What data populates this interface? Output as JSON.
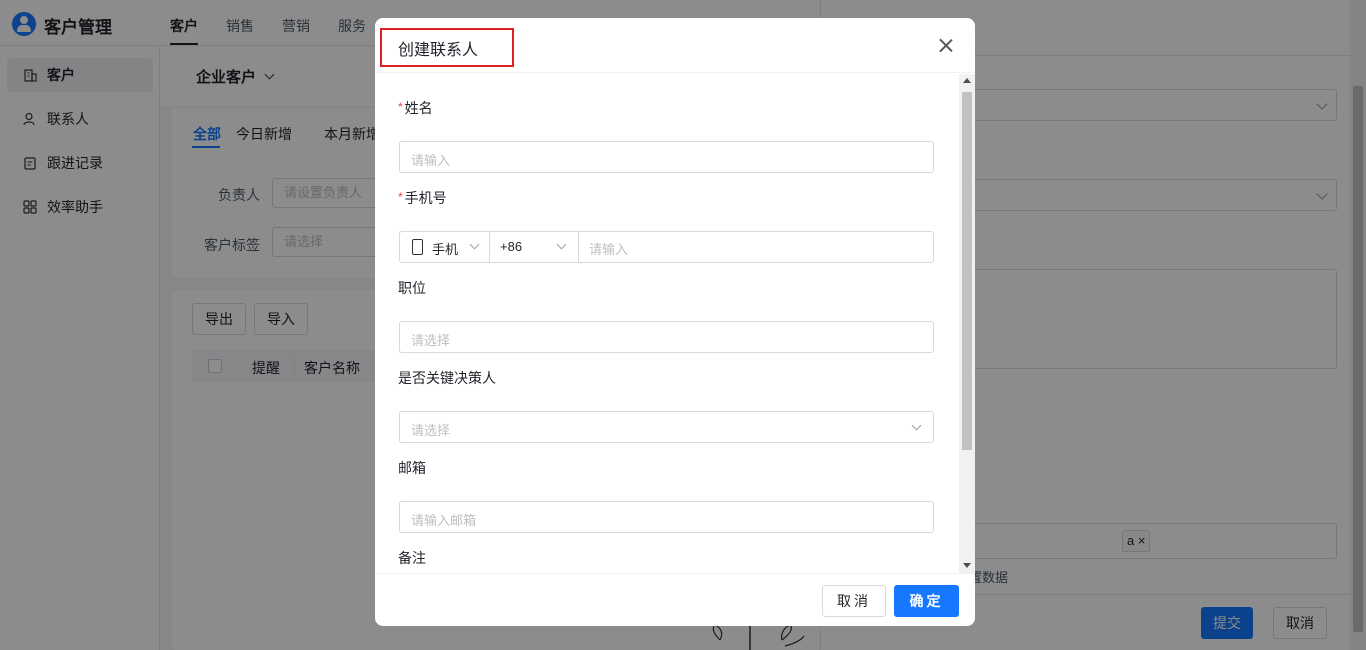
{
  "app": {
    "title": "客户管理",
    "top_tabs": [
      "客户",
      "销售",
      "营销",
      "服务"
    ]
  },
  "sidebar": {
    "items": [
      {
        "label": "客户",
        "icon": "building-icon"
      },
      {
        "label": "联系人",
        "icon": "person-icon"
      },
      {
        "label": "跟进记录",
        "icon": "clipboard-icon"
      },
      {
        "label": "效率助手",
        "icon": "grid-icon"
      }
    ]
  },
  "main": {
    "view_select": "企业客户",
    "filter_tabs": [
      "全部",
      "今日新增",
      "本月新增"
    ],
    "owner_label": "负责人",
    "owner_placeholder": "请设置负责人",
    "tag_label": "客户标签",
    "tag_placeholder": "请选择",
    "export_button": "导出",
    "import_button": "导入",
    "table_headers": [
      "提醒",
      "客户名称"
    ]
  },
  "right_panel": {
    "tag_partial": "a",
    "tag_remove": "×",
    "note_partial": "置数据",
    "submit": "提交",
    "cancel": "取消"
  },
  "modal": {
    "title": "创建联系人",
    "fields": {
      "name": {
        "label": "姓名",
        "required_mark": "*",
        "placeholder": "请输入"
      },
      "phone": {
        "label": "手机号",
        "required_mark": "*",
        "type": "手机",
        "country_code": "+86",
        "placeholder": "请输入"
      },
      "position": {
        "label": "职位",
        "placeholder": "请选择"
      },
      "decision_maker": {
        "label": "是否关键决策人",
        "placeholder": "请选择"
      },
      "email": {
        "label": "邮箱",
        "placeholder": "请输入邮箱"
      },
      "remark": {
        "label": "备注"
      }
    },
    "cancel": "取消",
    "confirm": "确定"
  },
  "colors": {
    "primary": "#1677ff",
    "required": "#f53f3f",
    "highlight_box": "#e02020"
  }
}
